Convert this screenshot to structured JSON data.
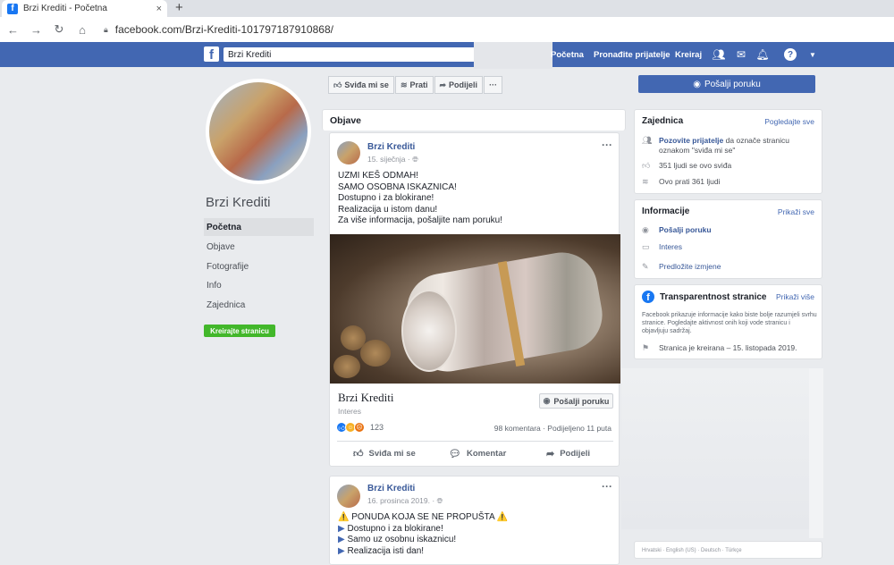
{
  "browser": {
    "tab_title": "Brzi Krediti - Početna",
    "tab_close": "×",
    "new_tab": "+",
    "url": "facebook.com/Brzi-Krediti-101797187910868/"
  },
  "fb_header": {
    "logo": "f",
    "search_value": "Brzi Krediti",
    "nav": [
      "Početna",
      "Pronađite prijatelje",
      "Kreiraj"
    ],
    "help": "?"
  },
  "page": {
    "name": "Brzi Krediti",
    "left_nav": [
      "Početna",
      "Objave",
      "Fotografije",
      "Info",
      "Zajednica"
    ],
    "create_page": "Kreirajte stranicu"
  },
  "actions": {
    "like": "Sviđa mi se",
    "follow": "Prati",
    "share": "Podijeli",
    "more": "···",
    "send_message": "Pošalji poruku"
  },
  "feed": {
    "header": "Objave",
    "post1": {
      "author": "Brzi Krediti",
      "date": "15. siječnja",
      "lines": [
        "UZMI KEŠ ODMAH!",
        "SAMO OSOBNA ISKAZNICA!",
        "Dostupno i za blokirane!",
        "Realizacija u istom danu!",
        "Za više informacija, pošaljite nam poruku!"
      ],
      "link_name": "Brzi Krediti",
      "link_category": "Interes",
      "link_button": "Pošalji poruku",
      "reaction_count": "123",
      "stats": "98 komentara · Podijeljeno 11 puta",
      "like": "Sviđa mi se",
      "comment": "Komentar",
      "share": "Podijeli"
    },
    "post2": {
      "author": "Brzi Krediti",
      "date": "16. prosinca 2019.",
      "lines": [
        "⚠️ PONUDA KOJA SE NE PROPUŠTA ⚠️",
        "Dostupno i za blokirane!",
        "Samo uz osobnu iskaznicu!",
        "Realizacija isti dan!"
      ]
    }
  },
  "sidebar": {
    "community": {
      "title": "Zajednica",
      "see_all": "Pogledajte sve",
      "invite_link": "Pozovite prijatelje",
      "invite_text": "da označe stranicu oznakom \"sviđa mi se\"",
      "likes": "351 ljudi se ovo sviđa",
      "follows": "Ovo prati 361 ljudi"
    },
    "info": {
      "title": "Informacije",
      "see_all": "Prikaži sve",
      "message": "Pošalji poruku",
      "category": "Interes",
      "suggest": "Predložite izmjene"
    },
    "transparency": {
      "title": "Transparentnost stranice",
      "see_more": "Prikaži više",
      "text": "Facebook prikazuje informacije kako biste bolje razumjeli svrhu stranice. Pogledajte aktivnost onih koji vode stranicu i objavljuju sadržaj.",
      "created": "Stranica je kreirana – 15. listopada 2019."
    },
    "footer_langs": "Hrvatski · English (US) · Deutsch · Türkçe"
  },
  "colors": {
    "fb_blue": "#4267b2",
    "link_blue": "#385898",
    "green": "#42b72a"
  }
}
